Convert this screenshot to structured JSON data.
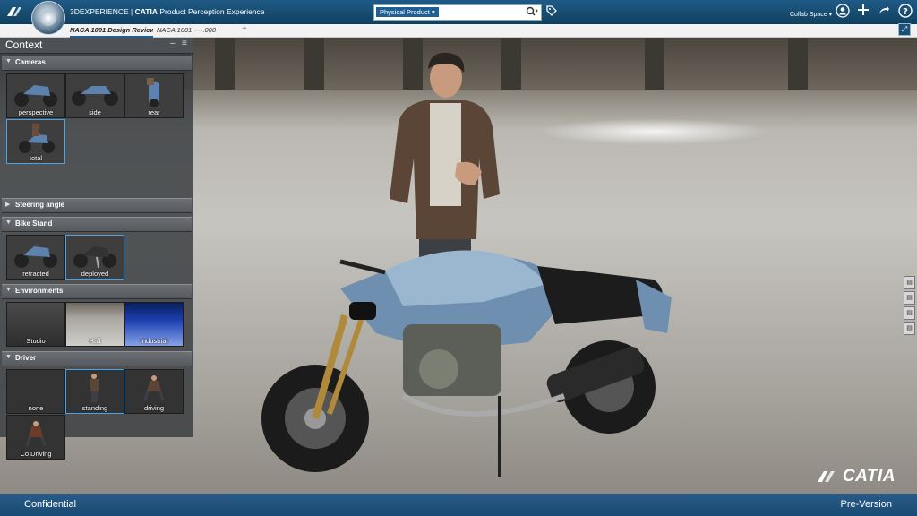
{
  "app": {
    "brand_3dx": "3DEXPERIENCE",
    "brand_catia": "CATIA",
    "brand_product": "Product Perception Experience",
    "logo_glyph": "3DS",
    "collab_space": "Collab Space"
  },
  "search": {
    "scope": "Physical Product",
    "placeholder": "",
    "value": ""
  },
  "tabs": [
    {
      "label": "NACA 1001 Design Review"
    },
    {
      "label": "NACA 1001 ----.000"
    }
  ],
  "panel": {
    "title": "Context",
    "sections": {
      "cameras": {
        "label": "Cameras",
        "items": [
          "perspective",
          "side",
          "rear",
          "total"
        ]
      },
      "steering": {
        "label": "Steering angle"
      },
      "bike_stand": {
        "label": "Bike Stand",
        "items": [
          "retracted",
          "deployed"
        ]
      },
      "environments": {
        "label": "Environments",
        "items": [
          "Studio",
          "Hall",
          "Industrial"
        ]
      },
      "driver": {
        "label": "Driver",
        "items": [
          "none",
          "standing",
          "driving",
          "Co Driving"
        ]
      }
    }
  },
  "viewport": {
    "watermark_brand": "CATIA"
  },
  "footer": {
    "left": "Confidential",
    "right": "Pre-Version"
  },
  "colors": {
    "topbar": "#1a4f78",
    "selection": "#4aa3e8"
  }
}
